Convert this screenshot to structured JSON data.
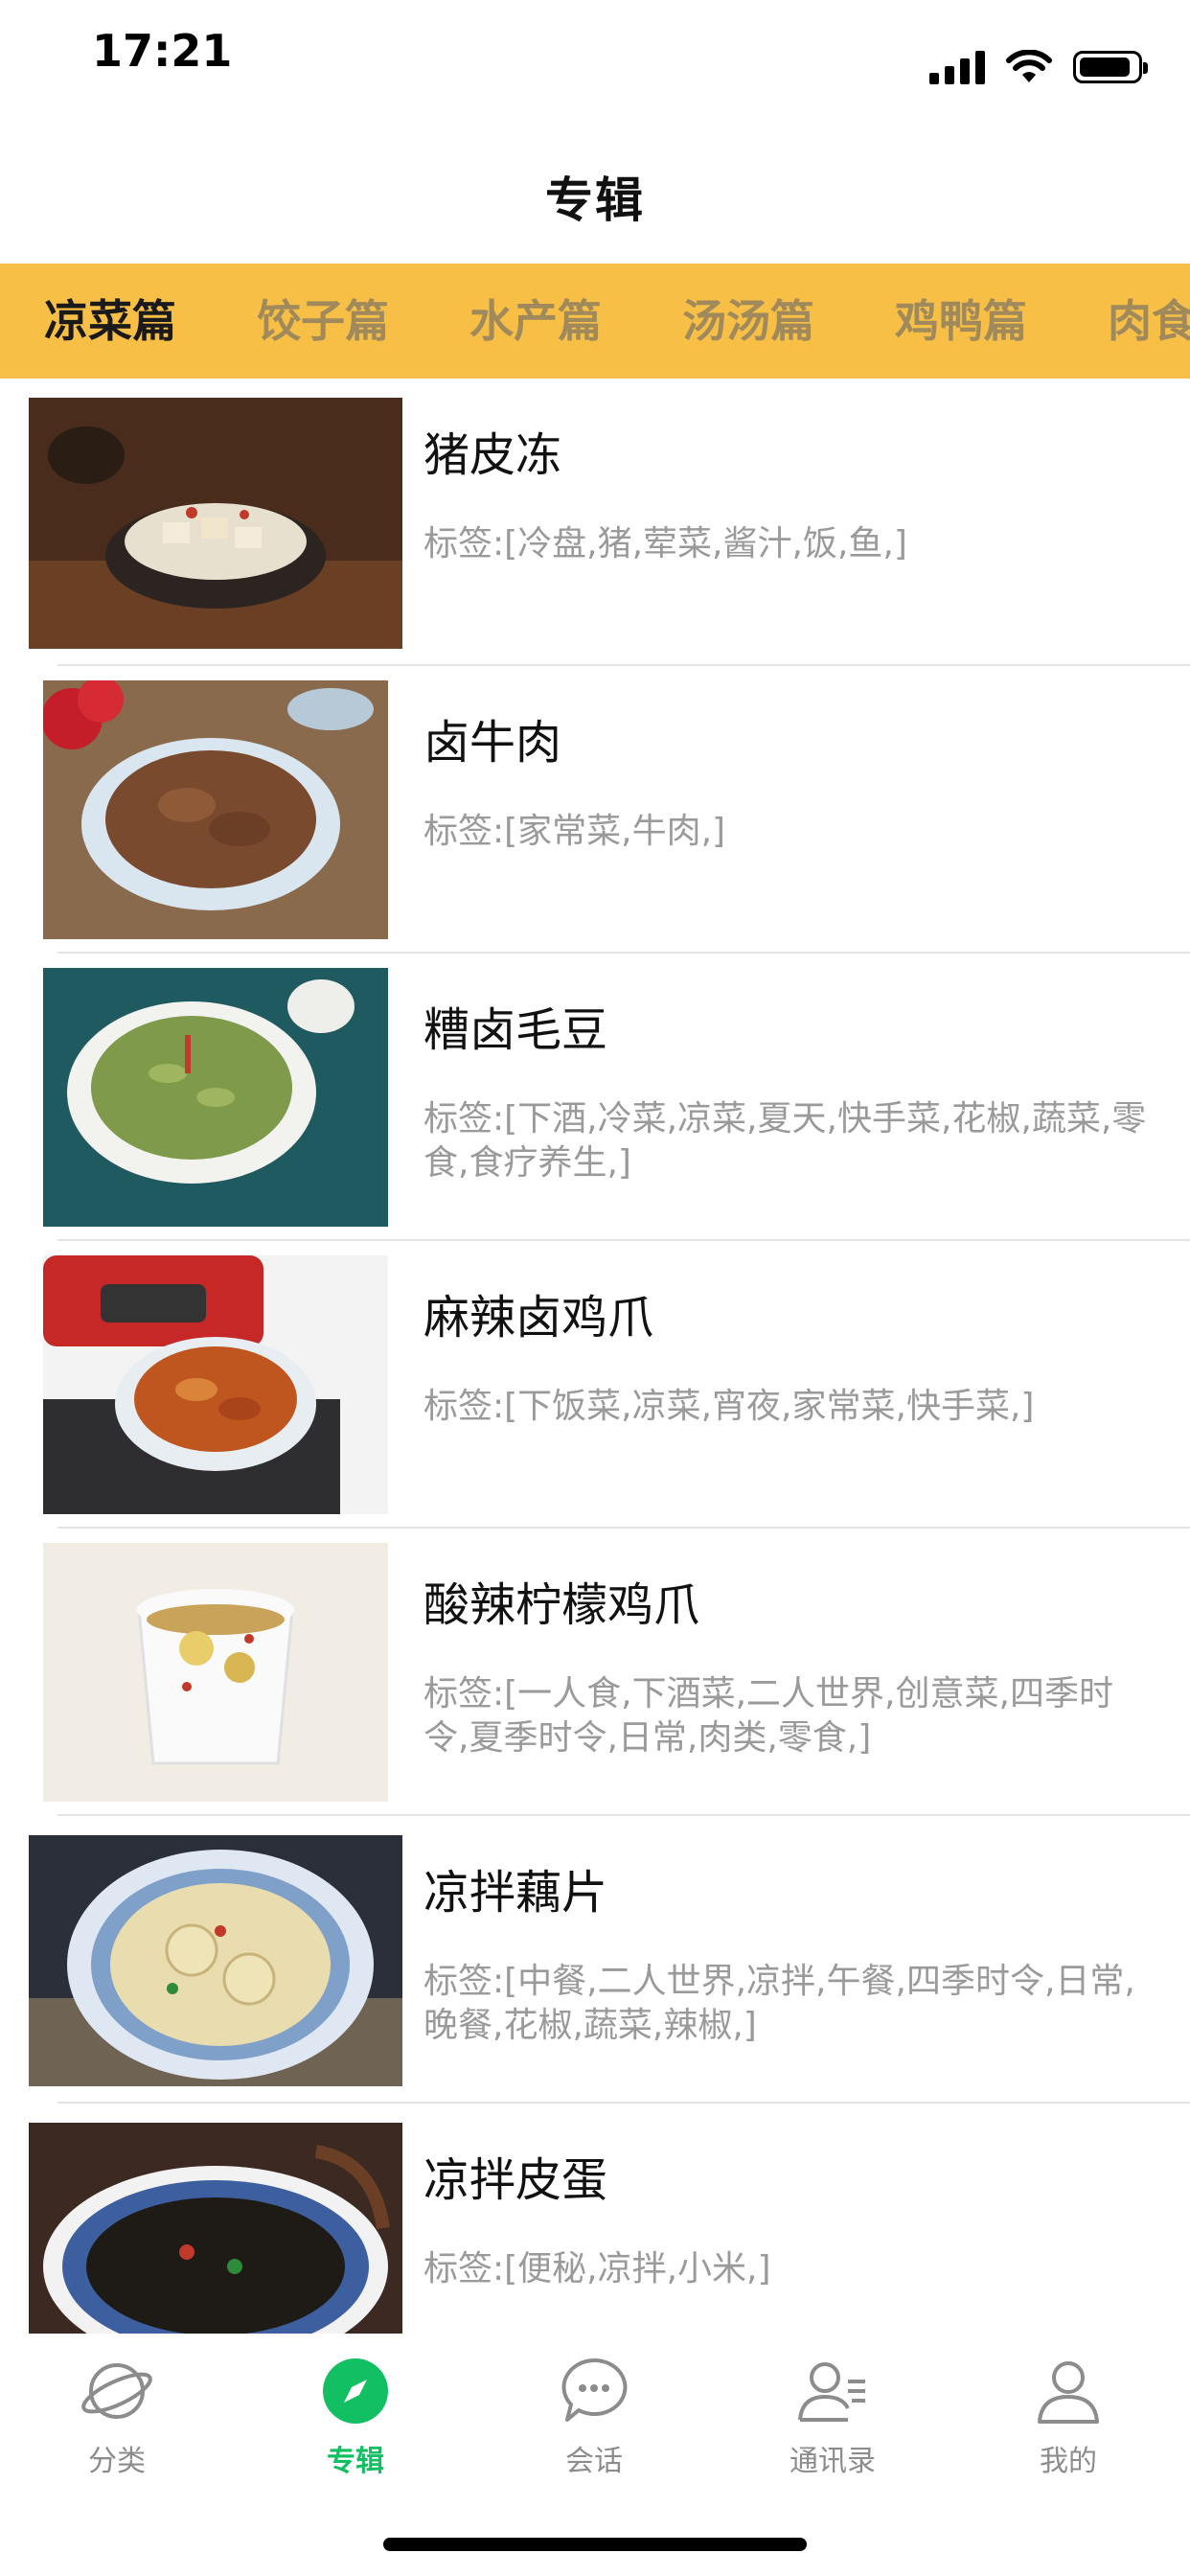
{
  "status_bar": {
    "time": "17:21"
  },
  "nav": {
    "title": "专辑"
  },
  "tabs": [
    {
      "label": "凉菜篇"
    },
    {
      "label": "饺子篇"
    },
    {
      "label": "水产篇"
    },
    {
      "label": "汤汤篇"
    },
    {
      "label": "鸡鸭篇"
    },
    {
      "label": "肉食篇"
    }
  ],
  "recipes": [
    {
      "title": "猪皮冻",
      "tags": "标签:[冷盘,猪,荤菜,酱汁,饭,鱼,]"
    },
    {
      "title": "卤牛肉",
      "tags": "标签:[家常菜,牛肉,]"
    },
    {
      "title": "糟卤毛豆",
      "tags": "标签:[下酒,冷菜,凉菜,夏天,快手菜,花椒,蔬菜,零食,食疗养生,]"
    },
    {
      "title": "麻辣卤鸡爪",
      "tags": "标签:[下饭菜,凉菜,宵夜,家常菜,快手菜,]"
    },
    {
      "title": "酸辣柠檬鸡爪",
      "tags": "标签:[一人食,下酒菜,二人世界,创意菜,四季时令,夏季时令,日常,肉类,零食,]"
    },
    {
      "title": "凉拌藕片",
      "tags": "标签:[中餐,二人世界,凉拌,午餐,四季时令,日常,晚餐,花椒,蔬菜,辣椒,]"
    },
    {
      "title": "凉拌皮蛋",
      "tags": "标签:[便秘,凉拌,小米,]"
    }
  ],
  "bottom_tabs": [
    {
      "label": "分类",
      "icon": "planet-icon"
    },
    {
      "label": "专辑",
      "icon": "compass-icon",
      "active": true
    },
    {
      "label": "会话",
      "icon": "chat-bubble-icon"
    },
    {
      "label": "通讯录",
      "icon": "contacts-icon"
    },
    {
      "label": "我的",
      "icon": "person-icon"
    }
  ],
  "colors": {
    "tab_bar_bg": "#f7bf46",
    "active_green": "#13bf63",
    "tag_gray": "#9a9a9a"
  }
}
